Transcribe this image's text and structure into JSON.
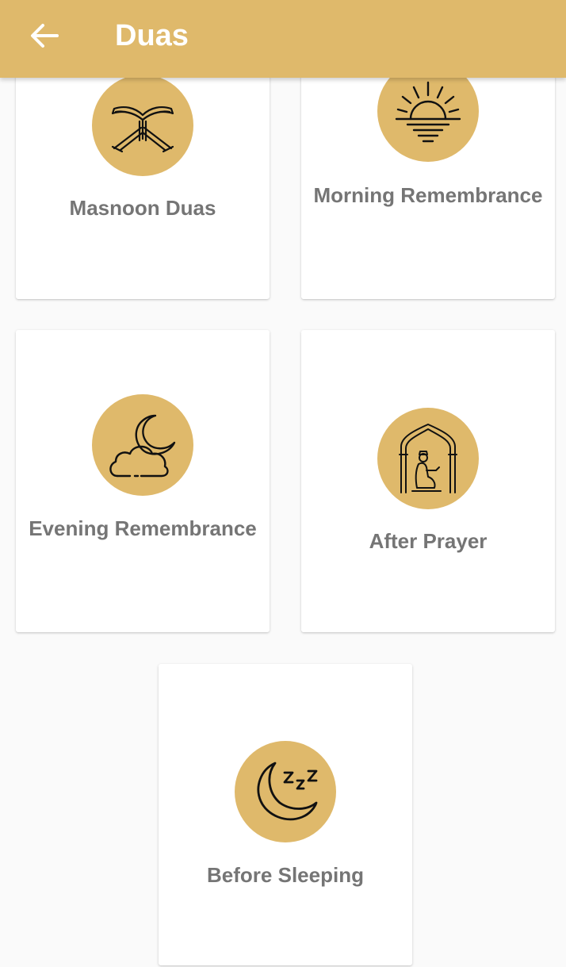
{
  "appbar": {
    "title": "Duas",
    "back_icon": "arrow-left-icon"
  },
  "colors": {
    "accent": "#dfb96b",
    "background": "#fafafa",
    "card": "#ffffff",
    "label": "#757575"
  },
  "categories": [
    {
      "label": "Masnoon Duas",
      "icon": "quran-stand-icon"
    },
    {
      "label": "Morning Remembrance",
      "icon": "sunrise-icon"
    },
    {
      "label": "Evening Remembrance",
      "icon": "moon-cloud-icon"
    },
    {
      "label": "After Prayer",
      "icon": "praying-person-icon"
    },
    {
      "label": "Before Sleeping",
      "icon": "sleeping-moon-icon"
    }
  ]
}
